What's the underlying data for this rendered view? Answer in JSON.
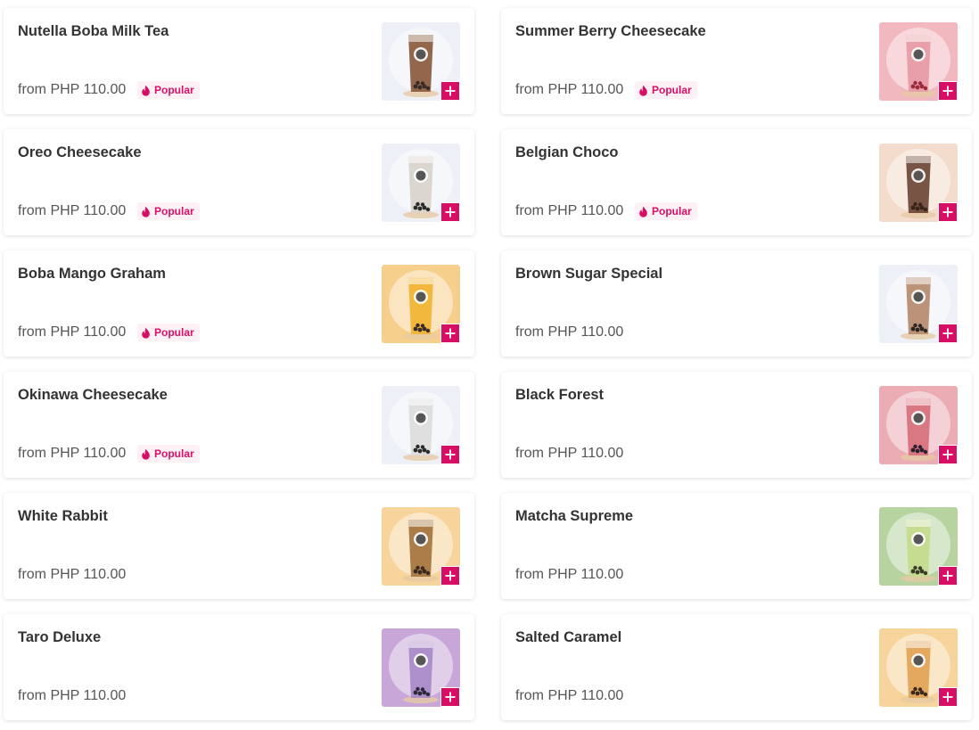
{
  "colors": {
    "accent": "#d70f64",
    "badge_bg": "#fdf1f6",
    "text_primary": "#333333",
    "text_secondary": "#555555"
  },
  "popular_icon": "flame-icon",
  "add_icon": "plus-icon",
  "items": [
    {
      "name": "Nutella Boba Milk Tea",
      "price": "from PHP 110.00",
      "badge": "Popular",
      "thumb_bg": "#eef0f8",
      "drink": "#8a5a3c",
      "topping": "#3a2a2a"
    },
    {
      "name": "Summer Berry Cheesecake",
      "price": "from PHP 110.00",
      "badge": "Popular",
      "thumb_bg": "#f2b8c0",
      "drink": "#e79aa4",
      "topping": "#9b2a3c"
    },
    {
      "name": "Oreo Cheesecake",
      "price": "from PHP 110.00",
      "badge": "Popular",
      "thumb_bg": "#eef0f8",
      "drink": "#d8d2cc",
      "topping": "#2b2b2b"
    },
    {
      "name": "Belgian Choco",
      "price": "from PHP 110.00",
      "badge": "Popular",
      "thumb_bg": "#f3dccb",
      "drink": "#6d4736",
      "topping": "#3a2418"
    },
    {
      "name": "Boba Mango Graham",
      "price": "from PHP 110.00",
      "badge": "Popular",
      "thumb_bg": "#f6cf8c",
      "drink": "#f0b432",
      "topping": "#3a2a2a"
    },
    {
      "name": "Brown Sugar Special",
      "price": "from PHP 110.00",
      "badge": "",
      "thumb_bg": "#eef0f8",
      "drink": "#b48a6c",
      "topping": "#2e2420"
    },
    {
      "name": "Okinawa Cheesecake",
      "price": "from PHP 110.00",
      "badge": "Popular",
      "thumb_bg": "#eef0f8",
      "drink": "#dcdcdc",
      "topping": "#2e2a2a"
    },
    {
      "name": "Black Forest",
      "price": "from PHP 110.00",
      "badge": "",
      "thumb_bg": "#ecacb4",
      "drink": "#d6707c",
      "topping": "#2e2030"
    },
    {
      "name": "White Rabbit",
      "price": "from PHP 110.00",
      "badge": "",
      "thumb_bg": "#f6d49c",
      "drink": "#a4743e",
      "topping": "#3a2a20"
    },
    {
      "name": "Matcha Supreme",
      "price": "from PHP 110.00",
      "badge": "",
      "thumb_bg": "#b7d3a0",
      "drink": "#c4db8c",
      "topping": "#3a3a2a"
    },
    {
      "name": "Taro Deluxe",
      "price": "from PHP 110.00",
      "badge": "",
      "thumb_bg": "#c8a6d8",
      "drink": "#a88ac8",
      "topping": "#2e2a3a"
    },
    {
      "name": "Salted Caramel",
      "price": "from PHP 110.00",
      "badge": "",
      "thumb_bg": "#f6d49c",
      "drink": "#e2a456",
      "topping": "#3a2a20"
    }
  ]
}
